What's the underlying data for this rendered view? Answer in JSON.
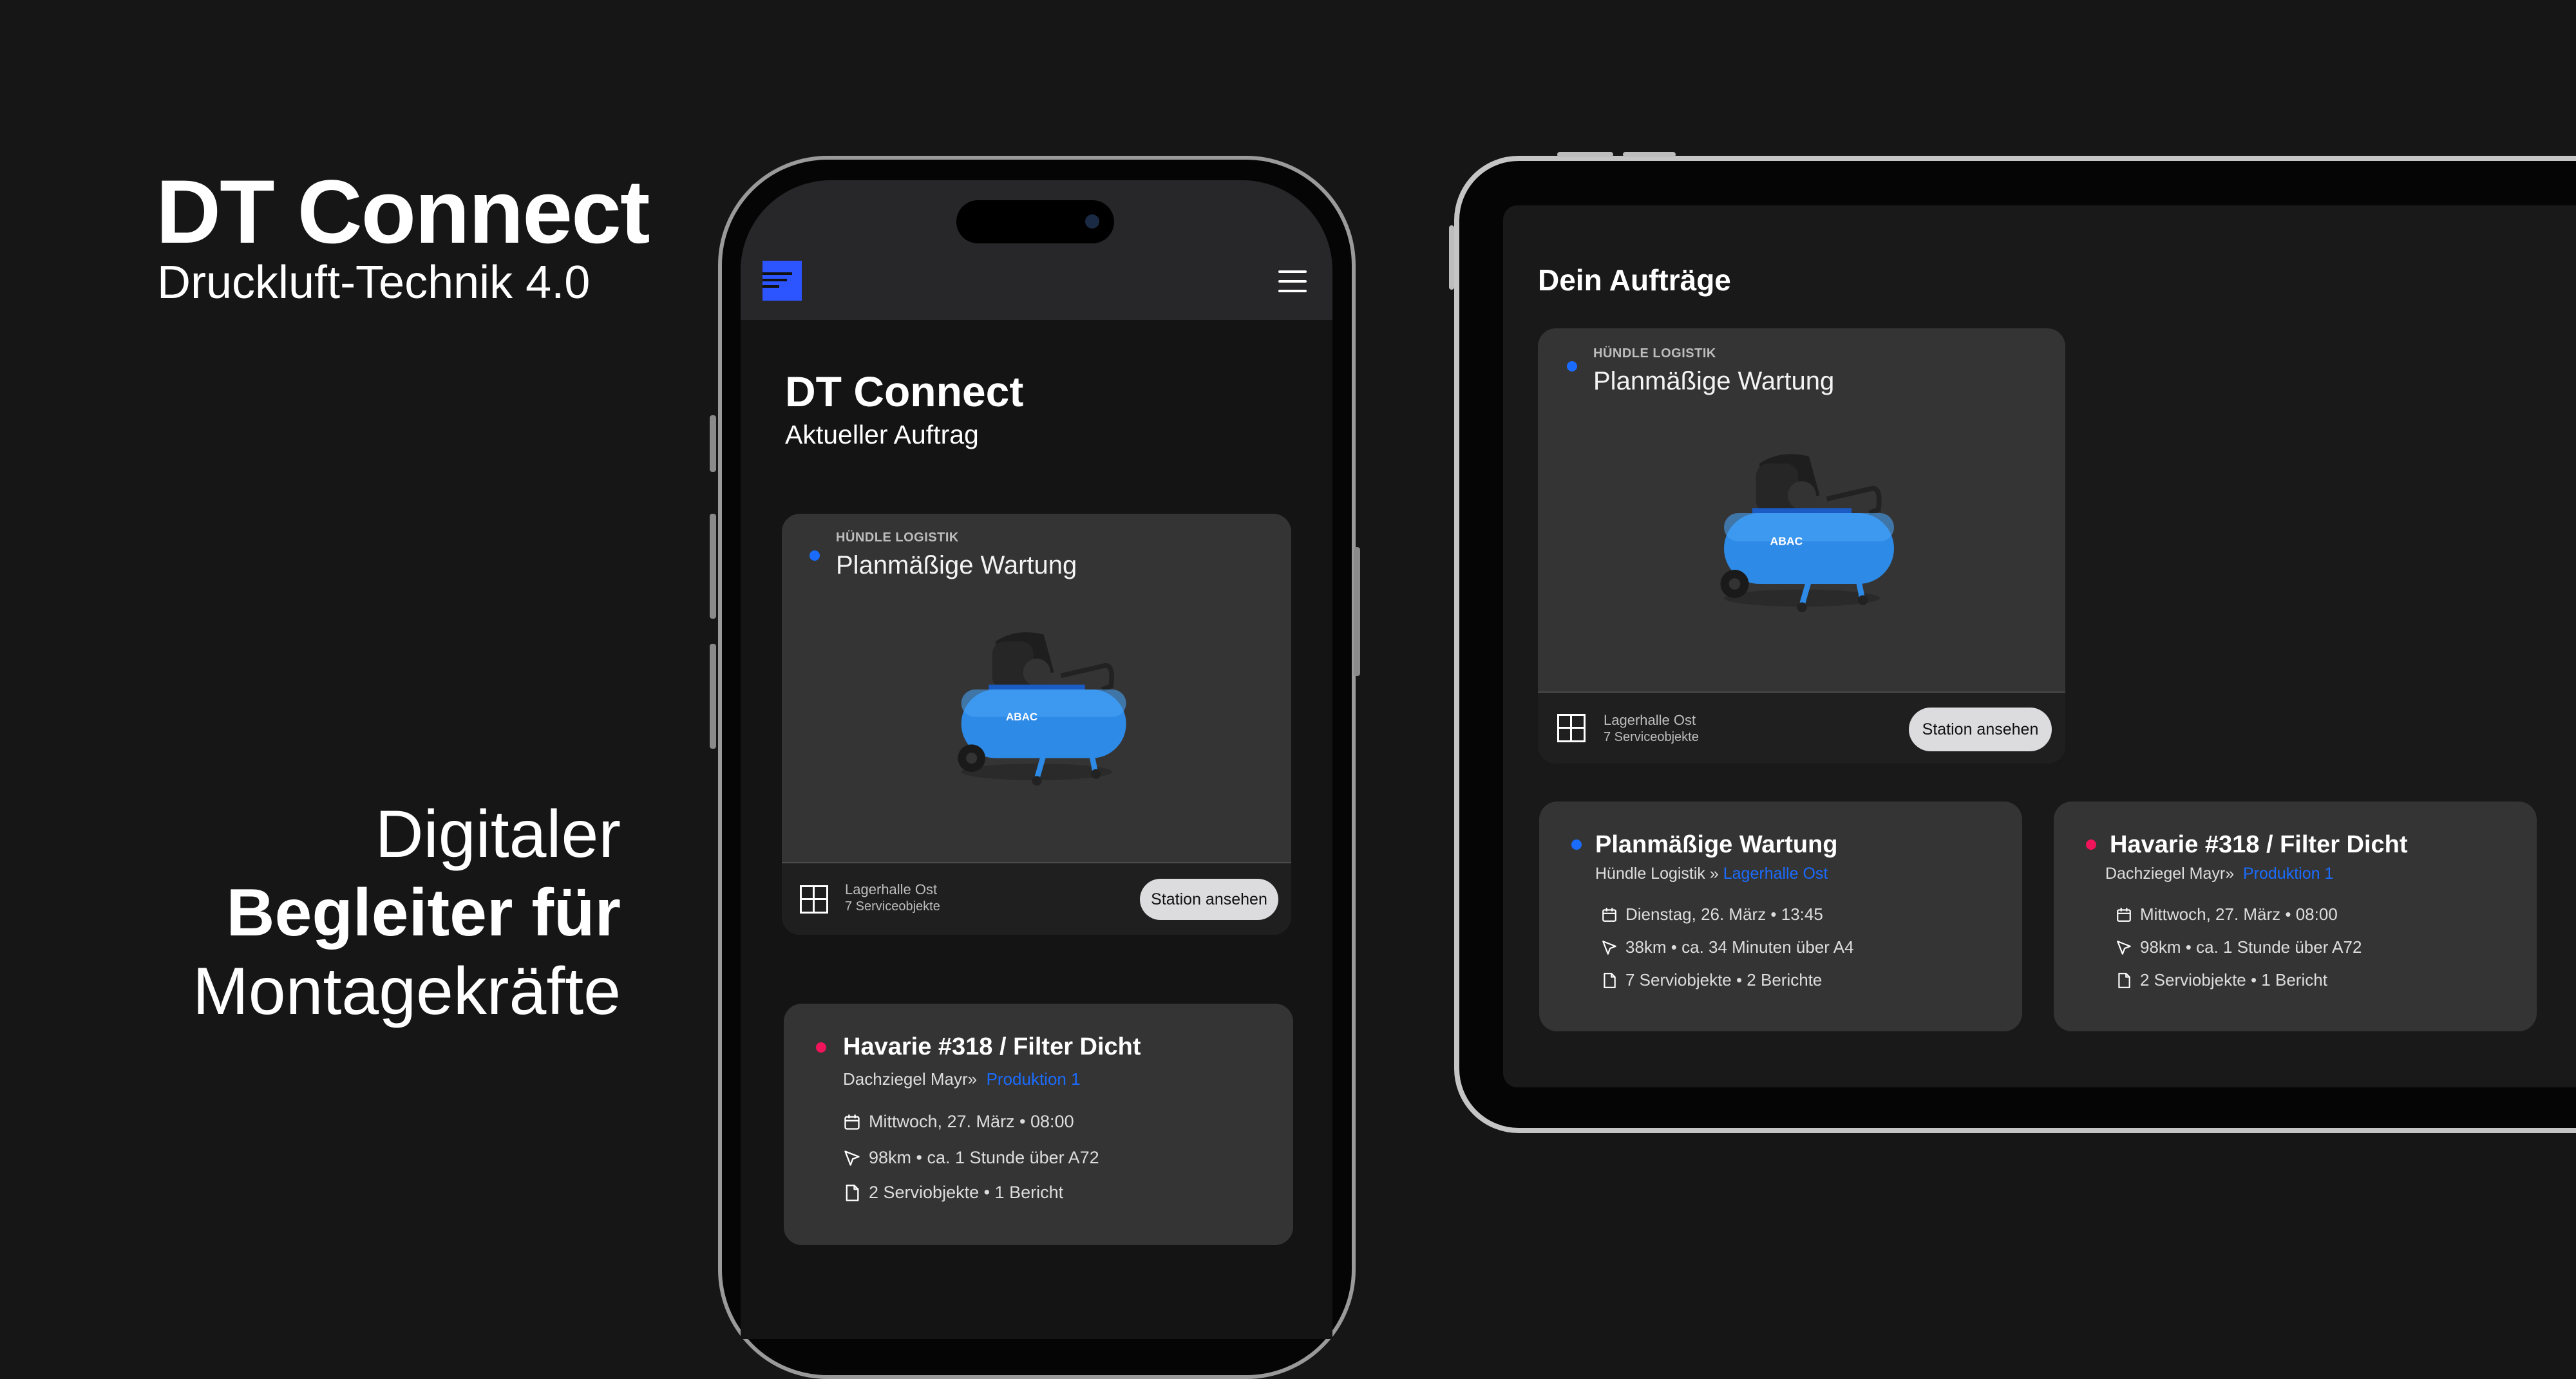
{
  "hero": {
    "title": "DT Connect",
    "subtitle": "Druckluft-Technik 4.0",
    "tagline": [
      "Digitaler",
      "Begleiter für",
      "Montagekräfte"
    ]
  },
  "colors": {
    "background": "#161616",
    "accent": "#2d55ff",
    "link": "#1a6cff",
    "dot_blue": "#1a6cff",
    "dot_red": "#f0145a",
    "card": "#353434"
  },
  "phone": {
    "header": {
      "logo_icon": "dt-logo-icon",
      "menu_icon": "hamburger-menu-icon"
    },
    "title": "DT Connect",
    "subtitle": "Aktueller Auftrag",
    "current_job": {
      "customer": "HÜNDLE LOGISTIK",
      "title": "Planmäßige Wartung",
      "location": "Lagerhalle Ost",
      "objects": "7 Serviceobjekte",
      "button": "Station ansehen"
    },
    "next_job": {
      "title": "Havarie #318 / Filter Dicht",
      "customer": "Dachziegel Mayr",
      "sep": "»",
      "station": "Produktion 1",
      "date": "Mittwoch, 27. März • 08:00",
      "route": "98km • ca. 1 Stunde über A72",
      "objects": "2 Serviobjekte • 1 Bericht"
    }
  },
  "tablet": {
    "title": "Dein Aufträge",
    "current_job": {
      "customer": "HÜNDLE LOGISTIK",
      "title": "Planmäßige Wartung",
      "location": "Lagerhalle Ost",
      "objects": "7 Serviceobjekte",
      "button": "Station ansehen"
    },
    "jobs": [
      {
        "title": "Planmäßige Wartung",
        "customer": "Hündle Logistik",
        "sep": "»",
        "station": "Lagerhalle Ost",
        "date": "Dienstag, 26. März • 13:45",
        "route": "38km • ca. 34 Minuten über A4",
        "objects": "7 Serviobjekte • 2 Berichte",
        "status_color": "#1a6cff"
      },
      {
        "title": "Havarie #318 / Filter Dicht",
        "customer": "Dachziegel Mayr",
        "sep": "»",
        "station": "Produktion 1",
        "date": "Mittwoch, 27. März • 08:00",
        "route": "98km • ca. 1 Stunde über A72",
        "objects": "2 Serviobjekte • 1 Bericht",
        "status_color": "#f0145a"
      }
    ]
  }
}
